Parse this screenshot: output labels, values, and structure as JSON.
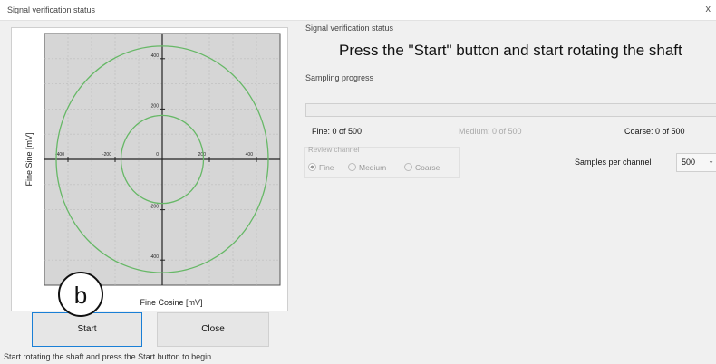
{
  "window": {
    "title": "Signal verification status",
    "close_glyph": "x"
  },
  "chart_data": {
    "type": "scatter",
    "xlabel": "Fine Cosine [mV]",
    "ylabel": "Fine Sine [mV]",
    "xlim": [
      -500,
      500
    ],
    "ylim": [
      -500,
      500
    ],
    "x_ticks": [
      -400,
      -200,
      0,
      200,
      400
    ],
    "x_tick_labels": [
      "-400",
      "-200",
      "0",
      "200",
      "400"
    ],
    "y_ticks": [
      400,
      200,
      -200,
      -400
    ],
    "y_tick_labels": [
      "400",
      "200",
      "-200",
      "-400"
    ],
    "grid": true,
    "series": [
      {
        "shape": "circle",
        "center": [
          0,
          0
        ],
        "radius": 450,
        "color": "#66b866"
      },
      {
        "shape": "circle",
        "center": [
          0,
          0
        ],
        "radius": 175,
        "color": "#66b866"
      }
    ],
    "plot_background": "#d6d6d6"
  },
  "status": {
    "section_label": "Signal verification status",
    "headline": "Press the \"Start\" button and start rotating the shaft"
  },
  "sampling": {
    "label": "Sampling progress",
    "progress": 0,
    "fine": "Fine: 0 of 500",
    "medium": "Medium: 0 of 500",
    "coarse": "Coarse: 0 of 500"
  },
  "review": {
    "label": "Review channel",
    "options": [
      "Fine",
      "Medium",
      "Coarse"
    ],
    "selected": "Fine"
  },
  "samples_per_channel": {
    "label": "Samples per channel",
    "value": "500"
  },
  "buttons": {
    "start": "Start",
    "close": "Close"
  },
  "statusbar": {
    "text": "Start rotating the shaft and press the Start button to begin."
  },
  "callout": {
    "label": "b"
  },
  "colors": {
    "accent": "#1a7fd6",
    "trace": "#66b866"
  }
}
